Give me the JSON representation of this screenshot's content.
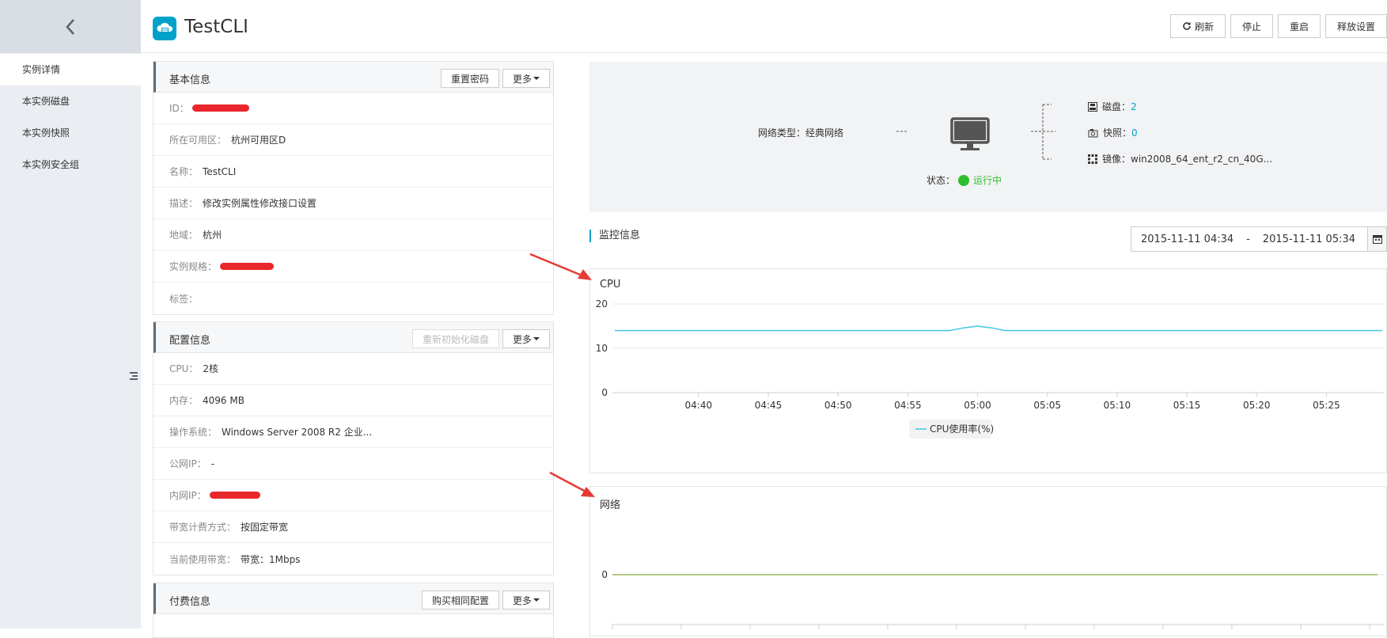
{
  "header": {
    "title": "TestCLI",
    "buttons": {
      "refresh": "刷新",
      "stop": "停止",
      "restart": "重启",
      "release": "释放设置"
    }
  },
  "sidebar": {
    "items": [
      "实例详情",
      "本实例磁盘",
      "本实例快照",
      "本实例安全组"
    ]
  },
  "basic_info": {
    "title": "基本信息",
    "reset_password": "重置密码",
    "more": "更多",
    "rows": [
      {
        "label": "ID：",
        "value": "",
        "redacted": true
      },
      {
        "label": "所在可用区：",
        "value": "杭州可用区D"
      },
      {
        "label": "名称：",
        "value": "TestCLI"
      },
      {
        "label": "描述：",
        "value": "修改实例属性修改接口设置"
      },
      {
        "label": "地域：",
        "value": "杭州"
      },
      {
        "label": "实例规格：",
        "value": "",
        "redacted": true
      },
      {
        "label": "标签：",
        "value": ""
      }
    ]
  },
  "config_info": {
    "title": "配置信息",
    "reinit_disk": "重新初始化磁盘",
    "more": "更多",
    "rows": [
      {
        "label": "CPU：",
        "value": "2核"
      },
      {
        "label": "内存：",
        "value": "4096 MB"
      },
      {
        "label": "操作系统：",
        "value": "Windows Server 2008 R2 企业..."
      },
      {
        "label": "公网IP：",
        "value": "-"
      },
      {
        "label": "内网IP：",
        "value": "",
        "redacted": true
      },
      {
        "label": "带宽计费方式：",
        "value": "按固定带宽"
      },
      {
        "label": "当前使用带宽：",
        "value": "带宽：1Mbps"
      }
    ]
  },
  "pay_info": {
    "title": "付费信息",
    "buy_same": "购买相同配置",
    "more": "更多"
  },
  "topology": {
    "network_label": "网络类型：",
    "network_value": "经典网络",
    "status_label": "状态：",
    "status_value": "运行中",
    "disk_label": "磁盘：",
    "disk_value": "2",
    "snapshot_label": "快照：",
    "snapshot_value": "0",
    "image_label": "镜像：",
    "image_value": "win2008_64_ent_r2_cn_40G..."
  },
  "monitor": {
    "title": "监控信息",
    "date_from": "2015-11-11 04:34",
    "date_sep": "-",
    "date_to": "2015-11-11 05:34"
  },
  "colors": {
    "accent": "#00a2ca",
    "status_green": "#2fbe2f",
    "cpu_line": "#3cc8e0",
    "net_line": "#9ab65c",
    "annotation_arrow": "#e53a35"
  },
  "chart_data": [
    {
      "type": "line",
      "title": "CPU",
      "x": [
        "04:40",
        "04:45",
        "04:50",
        "04:55",
        "05:00",
        "05:05",
        "05:10",
        "05:15",
        "05:20",
        "05:25"
      ],
      "yticks": [
        0,
        10,
        20
      ],
      "ylim": [
        0,
        20
      ],
      "series": [
        {
          "name": "CPU使用率(%)",
          "points": [
            [
              "04:34",
              14
            ],
            [
              "04:40",
              14
            ],
            [
              "04:45",
              14
            ],
            [
              "04:50",
              14
            ],
            [
              "04:55",
              14
            ],
            [
              "04:58",
              14
            ],
            [
              "04:59",
              14.6
            ],
            [
              "05:00",
              15
            ],
            [
              "05:01",
              14.6
            ],
            [
              "05:02",
              14
            ],
            [
              "05:05",
              14
            ],
            [
              "05:10",
              14
            ],
            [
              "05:15",
              14
            ],
            [
              "05:20",
              14
            ],
            [
              "05:25",
              14
            ],
            [
              "05:29",
              14
            ]
          ]
        }
      ],
      "legend": "bottom-center",
      "grid": true
    },
    {
      "type": "line",
      "title": "网络",
      "yticks": [
        0
      ],
      "series": [
        {
          "points": [
            [
              "04:34",
              0
            ],
            [
              "05:29",
              0
            ]
          ]
        }
      ],
      "grid": true
    }
  ]
}
